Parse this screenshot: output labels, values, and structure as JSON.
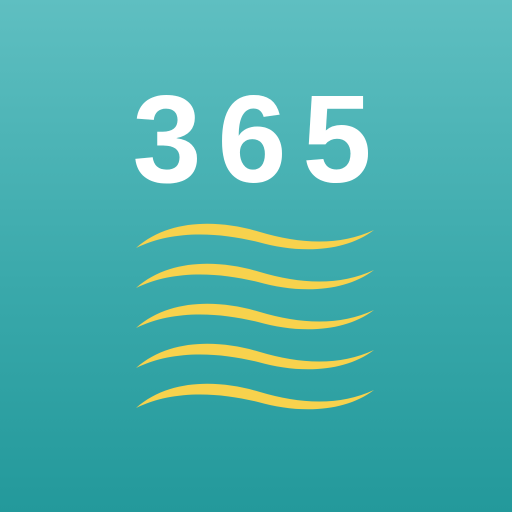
{
  "icon": {
    "title": "365",
    "icon_name": "waves-icon",
    "colors": {
      "background_top": "#5fbfc1",
      "background_bottom": "#23999b",
      "title": "#ffffff",
      "waves": "#f7d24d"
    },
    "wave_count": 5
  }
}
